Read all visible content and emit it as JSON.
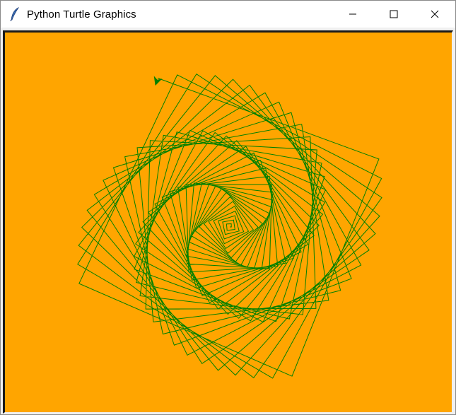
{
  "window": {
    "title": "Python Turtle Graphics",
    "icon": "feather-icon",
    "controls": [
      "minimize-icon",
      "maximize-icon",
      "close-icon"
    ]
  },
  "canvas": {
    "background_color": "#ffa500",
    "pen_color": "#008000",
    "drawing": "square spiral",
    "turtle_shape": "arrow"
  }
}
